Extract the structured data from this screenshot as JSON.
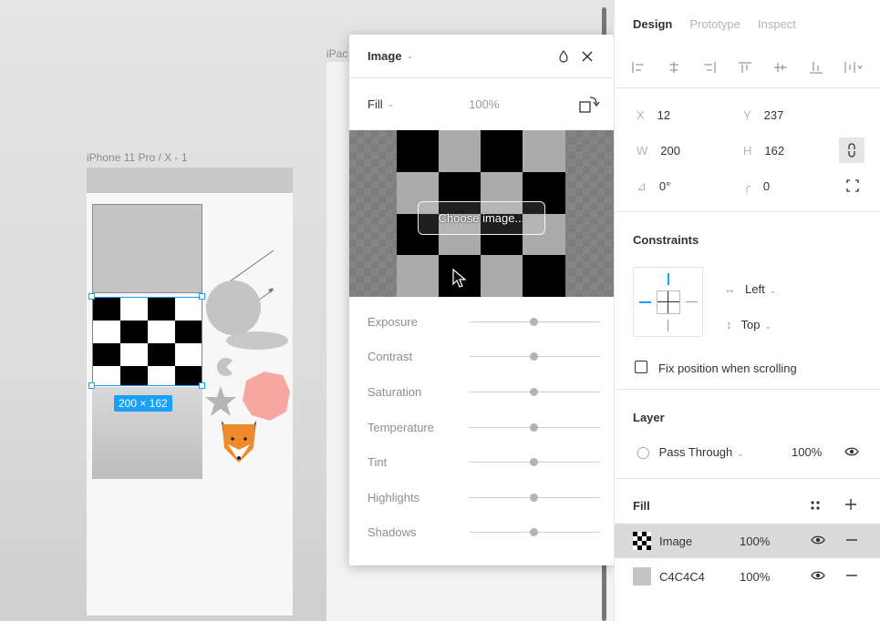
{
  "canvas": {
    "phone_frame_label": "iPhone 11 Pro / X - 1",
    "ipad_frame_label": "iPac",
    "selection_size": "200 × 162"
  },
  "popover": {
    "title": "Image",
    "fill_mode": "Fill",
    "fill_opacity": "100%",
    "choose_image_label": "Choose image...",
    "adjustments": [
      {
        "label": "Exposure",
        "value": 0
      },
      {
        "label": "Contrast",
        "value": 0
      },
      {
        "label": "Saturation",
        "value": 0
      },
      {
        "label": "Temperature",
        "value": 0
      },
      {
        "label": "Tint",
        "value": 0
      },
      {
        "label": "Highlights",
        "value": 0
      },
      {
        "label": "Shadows",
        "value": 0
      }
    ]
  },
  "panel": {
    "tabs": [
      "Design",
      "Prototype",
      "Inspect"
    ],
    "active_tab": "Design",
    "x_label": "X",
    "x_value": "12",
    "y_label": "Y",
    "y_value": "237",
    "w_label": "W",
    "w_value": "200",
    "h_label": "H",
    "h_value": "162",
    "rotation": "0°",
    "corner_radius": "0",
    "constraints": {
      "title": "Constraints",
      "horizontal": "Left",
      "vertical": "Top",
      "fix_position_label": "Fix position when scrolling"
    },
    "layer": {
      "title": "Layer",
      "blend_mode": "Pass Through",
      "opacity": "100%"
    },
    "fill": {
      "title": "Fill",
      "items": [
        {
          "name": "Image",
          "opacity": "100%"
        },
        {
          "name": "C4C4C4",
          "opacity": "100%",
          "color": "#C4C4C4"
        }
      ]
    }
  },
  "colors": {
    "accent": "#18A0FB",
    "fill_swatch": "#C4C4C4"
  }
}
